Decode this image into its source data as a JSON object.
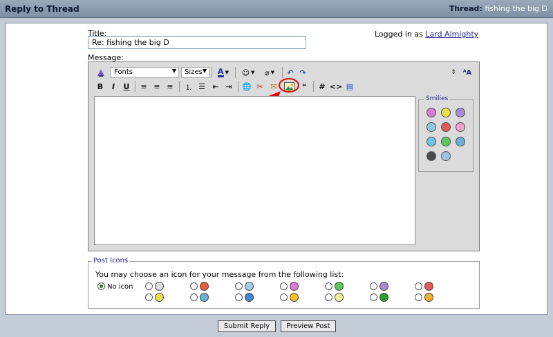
{
  "header": {
    "title": "Reply to Thread",
    "thread_label": "Thread:",
    "thread_name": "fishing the big D"
  },
  "form": {
    "title_label": "Title:",
    "title_value": "Re: fishing the big D",
    "logged_in_prefix": "Logged in as",
    "username": "Lard Almighty",
    "message_label": "Message:"
  },
  "toolbar": {
    "font_select": "Fonts",
    "size_select": "Sizes",
    "bold": "B",
    "italic": "I",
    "underline": "U",
    "hash": "#",
    "code": "<>"
  },
  "smilies": {
    "legend": "Smilies",
    "colors": [
      "#d97ad6",
      "#e6e04a",
      "#a78ad8",
      "#8cc9e6",
      "#e25a5a",
      "#f2a0d0",
      "#6ec2e8",
      "#5cc75c",
      "#6ab0d8",
      "#4a4a4a",
      "#9fc3e6"
    ]
  },
  "post_icons": {
    "legend": "Post Icons",
    "help": "You may choose an icon for your message from the following list:",
    "no_icon": "No icon",
    "colors": [
      "#dddddd",
      "#e0603a",
      "#9fd0ea",
      "#d97ad6",
      "#5cc75c",
      "#a78ad8",
      "#e25a5a",
      "#e6e04a",
      "#6ab0d8",
      "#3a8ad8",
      "#f0c020",
      "#f7f0a0",
      "#2aa02a",
      "#f0b030"
    ]
  },
  "buttons": {
    "submit": "Submit Reply",
    "preview": "Preview Post"
  },
  "annotation": {
    "color": "#e10000"
  }
}
